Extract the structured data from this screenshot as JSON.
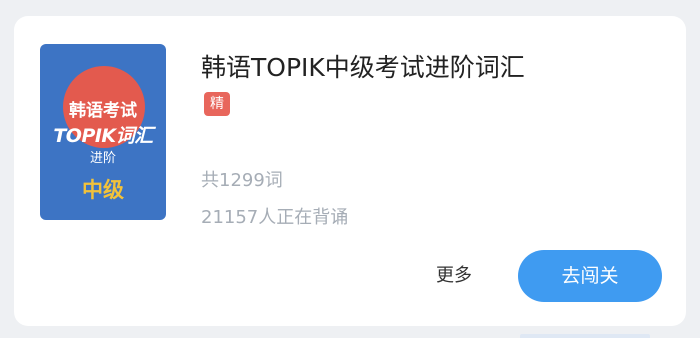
{
  "book": {
    "title": "韩语TOPIK中级考试进阶词汇",
    "badge": "精",
    "word_count": "共1299词",
    "learners": "21157人正在背诵",
    "cover": {
      "line1": "韩语考试",
      "line2": "TOPIK词汇",
      "line3": "进阶",
      "level": "中级"
    }
  },
  "actions": {
    "more_label": "更多",
    "start_label": "去闯关"
  },
  "colors": {
    "accent": "#3f9bf1",
    "badge": "#e8665c",
    "cover_bg": "#3d74c4",
    "cover_circle": "#e35a4e",
    "cover_level": "#f2c23a"
  }
}
